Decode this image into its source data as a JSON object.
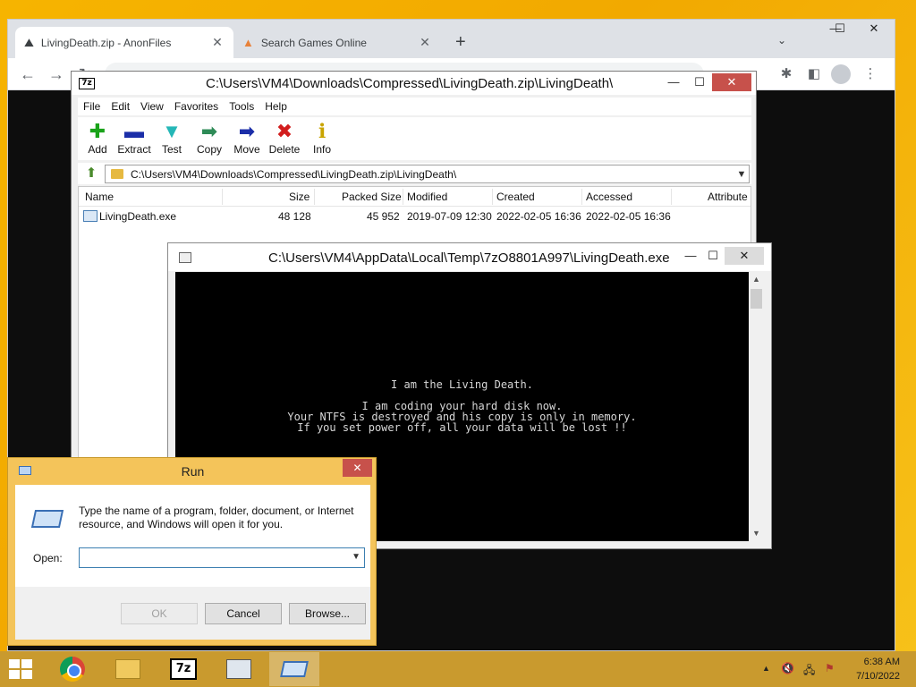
{
  "browser": {
    "tabs": [
      {
        "title": "LivingDeath.zip - AnonFiles",
        "active": true
      },
      {
        "title": "Search Games Online",
        "active": false
      }
    ],
    "new_tab": "+",
    "tab_search": "⌄",
    "window_controls": {
      "minimize": "—",
      "maximize": "☐",
      "close": "✕"
    },
    "nav": {
      "back": "←",
      "forward": "→",
      "reload": "↻"
    },
    "extensions": [
      "puzzle-icon",
      "sidebar-icon",
      "profile-icon",
      "menu-icon"
    ],
    "menu_glyph": "⋮"
  },
  "zip": {
    "title": "C:\\Users\\VM4\\Downloads\\Compressed\\LivingDeath.zip\\LivingDeath\\",
    "window_controls": {
      "minimize": "—",
      "maximize": "☐",
      "close": "✕"
    },
    "menu": [
      "File",
      "Edit",
      "View",
      "Favorites",
      "Tools",
      "Help"
    ],
    "toolbar": [
      {
        "label": "Add",
        "glyph": "✚",
        "color": "#1aa31a"
      },
      {
        "label": "Extract",
        "glyph": "▬",
        "color": "#1b2ea8"
      },
      {
        "label": "Test",
        "glyph": "▼",
        "color": "#25b7b7"
      },
      {
        "label": "Copy",
        "glyph": "➡",
        "color": "#2e8b57"
      },
      {
        "label": "Move",
        "glyph": "➡",
        "color": "#1b2ea8"
      },
      {
        "label": "Delete",
        "glyph": "✖",
        "color": "#d21d1d"
      },
      {
        "label": "Info",
        "glyph": "ℹ",
        "color": "#c9a400"
      }
    ],
    "path": "C:\\Users\\VM4\\Downloads\\Compressed\\LivingDeath.zip\\LivingDeath\\",
    "columns": [
      "Name",
      "Size",
      "Packed Size",
      "Modified",
      "Created",
      "Accessed",
      "Attribute"
    ],
    "rows": [
      {
        "name": "LivingDeath.exe",
        "size": "48 128",
        "packed": "45 952",
        "modified": "2019-07-09 12:30",
        "created": "2022-02-05 16:36",
        "accessed": "2022-02-05 16:36"
      }
    ]
  },
  "console": {
    "title": "C:\\Users\\VM4\\AppData\\Local\\Temp\\7zO8801A997\\LivingDeath.exe",
    "window_controls": {
      "minimize": "—",
      "maximize": "☐",
      "close": "✕"
    },
    "lines": [
      "I am the Living Death.",
      "I am coding your hard disk now.",
      "Your NTFS is destroyed and his copy is only in memory.",
      "If you set power off, all your data will be lost !!"
    ],
    "scroll_up": "▲",
    "scroll_down": "▼"
  },
  "run": {
    "title": "Run",
    "close": "✕",
    "description": "Type the name of a program, folder, document, or Internet resource, and Windows will open it for you.",
    "open_label": "Open:",
    "open_value": "",
    "open_chevron": "⌄",
    "ok": "OK",
    "cancel": "Cancel",
    "browse": "Browse..."
  },
  "taskbar": {
    "items": [
      "chrome-icon",
      "file-explorer-icon",
      "7zip-icon",
      "console-icon",
      "run-icon"
    ],
    "sevenzip_label": "7z",
    "tray": {
      "chevron": "▲",
      "volume": "🔇",
      "network": "🖧",
      "flag": "⚑"
    },
    "time": "6:38 AM",
    "date": "7/10/2022"
  }
}
